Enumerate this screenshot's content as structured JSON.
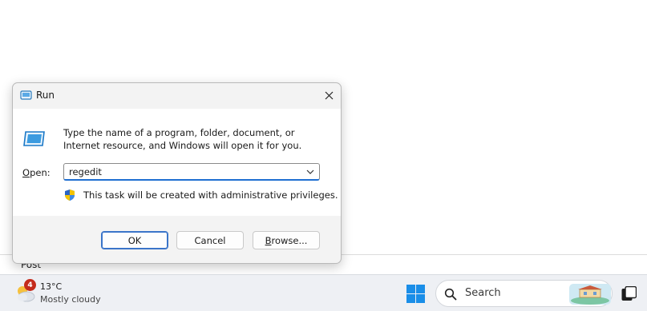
{
  "background": {
    "partial_text": "Post"
  },
  "dialog": {
    "title": "Run",
    "description": "Type the name of a program, folder, document, or Internet resource, and Windows will open it for you.",
    "open_label_accel": "O",
    "open_label_rest": "pen:",
    "input_value": "regedit",
    "admin_note": "This task will be created with administrative privileges.",
    "buttons": {
      "ok": "OK",
      "cancel": "Cancel",
      "browse_accel": "B",
      "browse_rest": "rowse..."
    }
  },
  "taskbar": {
    "weather": {
      "badge_count": "4",
      "temperature": "13°C",
      "condition": "Mostly cloudy"
    },
    "search_placeholder": "Search"
  },
  "icons": [
    "run-icon",
    "close-icon",
    "run-app-icon",
    "chevron-down-icon",
    "uac-shield-icon",
    "weather-icon",
    "windows-start-icon",
    "search-icon",
    "search-highlight-icon",
    "task-view-icon"
  ],
  "colors": {
    "accent": "#1f6fd1",
    "badge": "#c42b1c",
    "dialog_bg": "#f3f3f3",
    "taskbar_bg": "#eef0f4"
  }
}
